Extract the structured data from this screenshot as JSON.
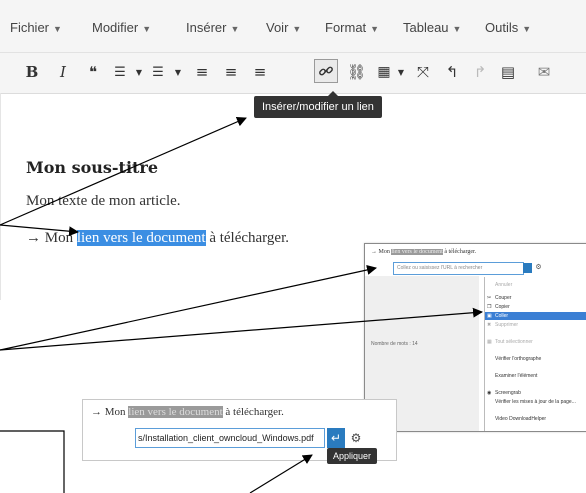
{
  "menubar": {
    "items": [
      {
        "label": "Fichier"
      },
      {
        "label": "Modifier"
      },
      {
        "label": "Insérer"
      },
      {
        "label": "Voir"
      },
      {
        "label": "Format"
      },
      {
        "label": "Tableau"
      },
      {
        "label": "Outils"
      }
    ]
  },
  "toolbar": {
    "icons": [
      "bold-icon",
      "italic-icon",
      "blockquote-icon",
      "bullet-list-icon",
      "numbered-list-icon",
      "align-left-icon",
      "align-center-icon",
      "align-right-icon",
      "link-icon",
      "unlink-icon",
      "table-icon",
      "fullscreen-icon",
      "undo-icon",
      "redo-icon",
      "wp-more-icon",
      "mail-icon"
    ],
    "glyphs": {
      "bold": "B",
      "italic": "I",
      "quote": "❝",
      "ul": "☰",
      "ol": "☰",
      "alignleft": "≡",
      "aligncenter": "≡",
      "alignright": "≡",
      "link": "🔗",
      "unlink": "⛓",
      "table": "▦",
      "fullscreen": "⤧",
      "undo": "↰",
      "redo": "↱",
      "more": "▤",
      "mail": "✉"
    }
  },
  "tooltip": {
    "text": "Insérer/modifier un lien"
  },
  "content": {
    "heading": "Mon sous-titre",
    "paragraph": "Mon texte de mon article.",
    "link_line_prefix": "→ Mon ",
    "link_text": "lien vers le document",
    "link_line_suffix": " à télécharger."
  },
  "panel2": {
    "line_prefix": "→ Mon ",
    "link_text": "lien vers le document",
    "line_suffix": " à télécharger.",
    "url_placeholder": "Collez ou saisissez l'URL à rechercher",
    "word_count": "Nombre de mots : 14",
    "context_menu": [
      {
        "label": "Annuler",
        "state": "disabled"
      },
      {
        "label": "Couper",
        "state": "normal"
      },
      {
        "label": "Copier",
        "state": "normal"
      },
      {
        "label": "Coller",
        "state": "selected"
      },
      {
        "label": "Supprimer",
        "state": "disabled"
      },
      {
        "label": "Tout sélectionner",
        "state": "disabled"
      },
      {
        "label": "Vérifier l'orthographe",
        "state": "normal"
      },
      {
        "label": "Examiner l'élément",
        "state": "normal"
      },
      {
        "label": "Screengrab",
        "state": "normal"
      },
      {
        "label": "Vérifier les mises à jour de la page...",
        "state": "normal"
      },
      {
        "label": "Video DownloadHelper",
        "state": "normal"
      }
    ]
  },
  "panel3": {
    "line_prefix": "→ Mon ",
    "link_text": "lien vers le document",
    "line_suffix": " à télécharger.",
    "url_value": "s/Installation_client_owncloud_Windows.pdf",
    "tooltip": "Appliquer"
  },
  "colors": {
    "accent": "#3b8ee3",
    "apply_button": "#2a7bbf"
  }
}
